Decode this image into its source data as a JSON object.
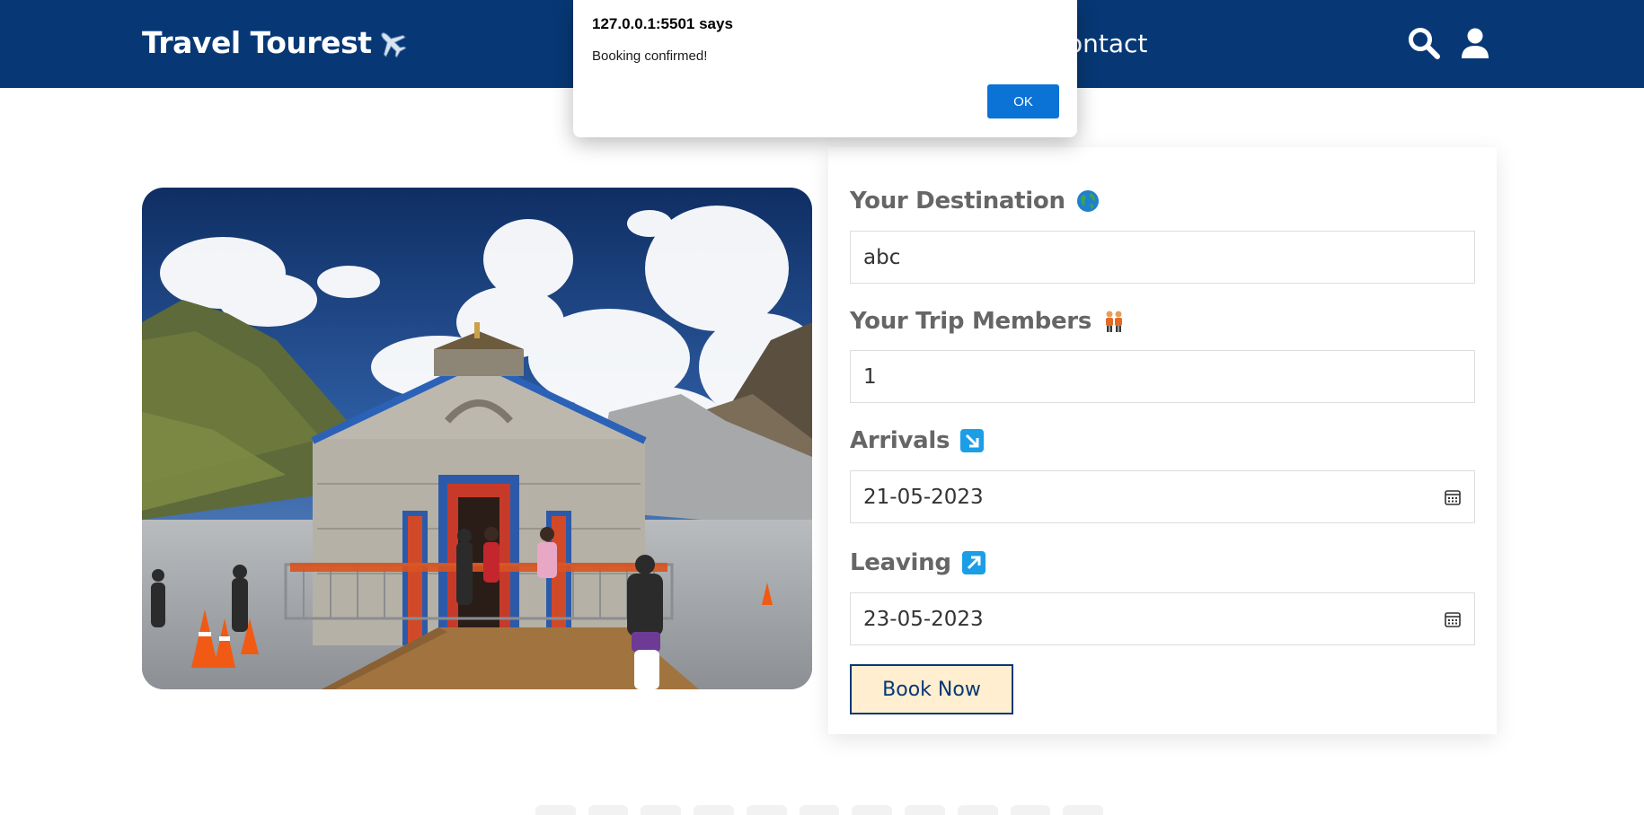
{
  "header": {
    "brand": "Travel Tourest",
    "brand_icon": "airplane-icon",
    "nav_link_partial": "ontact",
    "search_icon": "search-icon",
    "user_icon": "user-icon",
    "background_color": "#073875"
  },
  "photo": {
    "subject": "temple-photo"
  },
  "form": {
    "destination": {
      "label": "Your Destination",
      "icon": "globe-icon",
      "value": "abc"
    },
    "members": {
      "label": "Your Trip Members",
      "icon": "people-icon",
      "value": "1"
    },
    "arrivals": {
      "label": "Arrivals",
      "icon": "arrow-down-right-icon",
      "value": "21-05-2023"
    },
    "leaving": {
      "label": "Leaving",
      "icon": "arrow-up-right-icon",
      "value": "23-05-2023"
    },
    "submit_label": "Book Now",
    "submit_bg": "#ffeecf",
    "submit_border": "#073875"
  },
  "dialog": {
    "title": "127.0.0.1:5501 says",
    "message": "Booking confirmed!",
    "ok_label": "OK",
    "ok_color": "#0b72d6"
  }
}
